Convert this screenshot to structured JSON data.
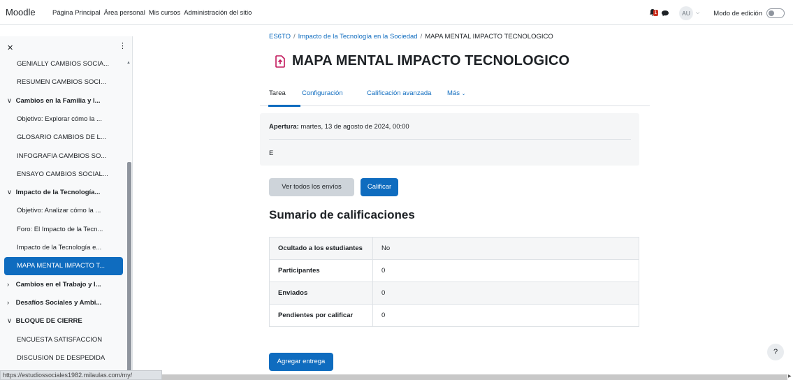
{
  "navbar": {
    "brand": "Moodle",
    "links": [
      "Página Principal",
      "Área personal",
      "Mis cursos",
      "Administración del sitio"
    ],
    "notification_count": "1",
    "user_initials": "AU",
    "edit_mode_label": "Modo de edición"
  },
  "drawer": {
    "items": [
      {
        "label": "GENIALLY CAMBIOS SOCIA...",
        "type": "activity"
      },
      {
        "label": "RESUMEN CAMBIOS SOCI...",
        "type": "activity"
      },
      {
        "label": "Cambios en la Familia y l...",
        "type": "section",
        "expanded": true
      },
      {
        "label": "Objetivo: Explorar cómo la ...",
        "type": "activity"
      },
      {
        "label": "GLOSARIO CAMBIOS DE L...",
        "type": "activity"
      },
      {
        "label": "INFOGRAFIA CAMBIOS SO...",
        "type": "activity"
      },
      {
        "label": "ENSAYO CAMBIOS SOCIAL...",
        "type": "activity"
      },
      {
        "label": "Impacto de la Tecnología...",
        "type": "section",
        "expanded": true
      },
      {
        "label": "Objetivo: Analizar cómo la ...",
        "type": "activity"
      },
      {
        "label": "Foro: El Impacto de la Tecn...",
        "type": "activity"
      },
      {
        "label": "Impacto de la Tecnología e...",
        "type": "activity"
      },
      {
        "label": "MAPA MENTAL IMPACTO T...",
        "type": "activity",
        "active": true
      },
      {
        "label": "Cambios en el Trabajo y l...",
        "type": "section",
        "expanded": false
      },
      {
        "label": "Desafíos Sociales y Ambi...",
        "type": "section",
        "expanded": false
      },
      {
        "label": "BLOQUE DE CIERRE",
        "type": "section",
        "expanded": true
      },
      {
        "label": "ENCUESTA SATISFACCION",
        "type": "activity"
      },
      {
        "label": "DISCUSION DE DESPEDIDA",
        "type": "activity"
      }
    ]
  },
  "status_url": "https://estudiossociales1982.milaulas.com/my/",
  "breadcrumb": {
    "course": "ES6TO",
    "section": "Impacto de la Tecnología en la Sociedad",
    "current": "MAPA MENTAL IMPACTO TECNOLOGICO"
  },
  "page_title": "MAPA MENTAL IMPACTO TECNOLOGICO",
  "tabs": [
    "Tarea",
    "Configuración",
    "Calificación avanzada",
    "Más"
  ],
  "dates": {
    "open_label": "Apertura:",
    "open_value": "martes, 13 de agosto de 2024, 00:00",
    "description": "E"
  },
  "buttons": {
    "view_all": "Ver todos los envíos",
    "grade": "Calificar",
    "add_submission": "Agregar entrega"
  },
  "summary": {
    "title": "Sumario de calificaciones",
    "rows": [
      {
        "label": "Ocultado a los estudiantes",
        "value": "No"
      },
      {
        "label": "Participantes",
        "value": "0"
      },
      {
        "label": "Enviados",
        "value": "0"
      },
      {
        "label": "Pendientes por calificar",
        "value": "0"
      }
    ]
  },
  "help_label": "?",
  "colors": {
    "primary": "#0f6cbf",
    "notification": "#ca3120"
  }
}
